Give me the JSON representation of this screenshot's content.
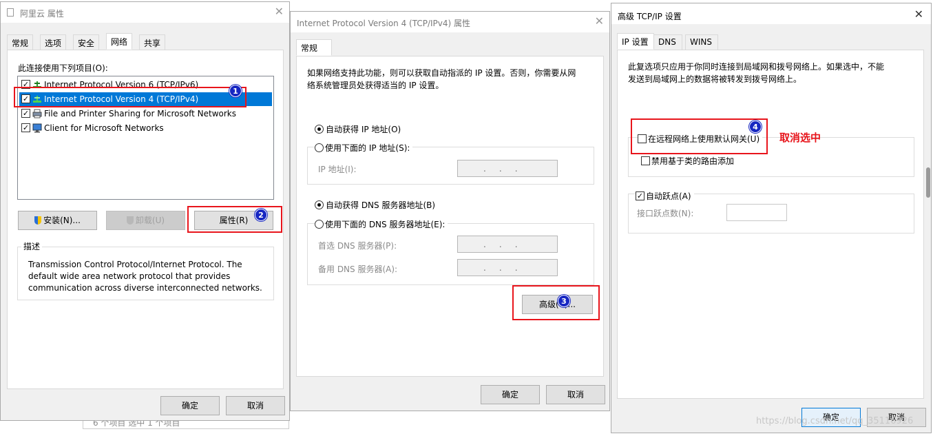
{
  "dialog1": {
    "title": "阿里云 属性",
    "tabs": [
      "常规",
      "选项",
      "安全",
      "网络",
      "共享"
    ],
    "active_tab": "网络",
    "list_label": "此连接使用下列项目(O):",
    "items": [
      {
        "label": "Internet Protocol Version 6 (TCP/IPv6)",
        "checked": true
      },
      {
        "label": "Internet Protocol Version 4 (TCP/IPv4)",
        "checked": true
      },
      {
        "label": "File and Printer Sharing for Microsoft Networks",
        "checked": true
      },
      {
        "label": "Client for Microsoft Networks",
        "checked": true
      }
    ],
    "install_label": "安装(N)...",
    "uninstall_label": "卸载(U)",
    "properties_label": "属性(R)",
    "description_heading": "描述",
    "description_text": "Transmission Control Protocol/Internet Protocol. The default wide area network protocol that provides communication across diverse interconnected networks.",
    "ok_label": "确定",
    "cancel_label": "取消",
    "behind_text": "6 个项目  选中 1 个项目"
  },
  "dialog2": {
    "title": "Internet Protocol Version 4 (TCP/IPv4) 属性",
    "tab": "常规",
    "intro": "如果网络支持此功能，则可以获取自动指派的 IP 设置。否则，你需要从网络系统管理员处获得适当的 IP 设置。",
    "auto_ip": "自动获得 IP 地址(O)",
    "manual_ip": "使用下面的 IP 地址(S):",
    "ip_label": "IP 地址(I):",
    "auto_dns": "自动获得 DNS 服务器地址(B)",
    "manual_dns": "使用下面的 DNS 服务器地址(E):",
    "preferred_dns": "首选 DNS 服务器(P):",
    "alternate_dns": "备用 DNS 服务器(A):",
    "ip_placeholder": ".     .     .",
    "advanced_label": "高级(V)...",
    "ok_label": "确定",
    "cancel_label": "取消"
  },
  "dialog3": {
    "title": "高级 TCP/IP 设置",
    "tabs": [
      "IP 设置",
      "DNS",
      "WINS"
    ],
    "active_tab": "IP 设置",
    "intro": "此复选项只应用于你同时连接到局域网和拨号网络上。如果选中，不能发送到局域网上的数据将被转发到拨号网络上。",
    "default_gateway": "在远程网络上使用默认网关(U)",
    "class_route": "禁用基于类的路由添加",
    "auto_metric": "自动跃点(A)",
    "interface_metric": "接口跃点数(N):",
    "ok_label": "确定",
    "cancel_label": "取消"
  },
  "annotations": {
    "badges": [
      "1",
      "2",
      "3",
      "4"
    ],
    "uncheck_note": "取消选中",
    "watermark": "https://blog.csdn.net/qq_35116926",
    "accent_color": "#e8141b",
    "badge_color": "#1727c2",
    "selection_color": "#0078d7"
  }
}
